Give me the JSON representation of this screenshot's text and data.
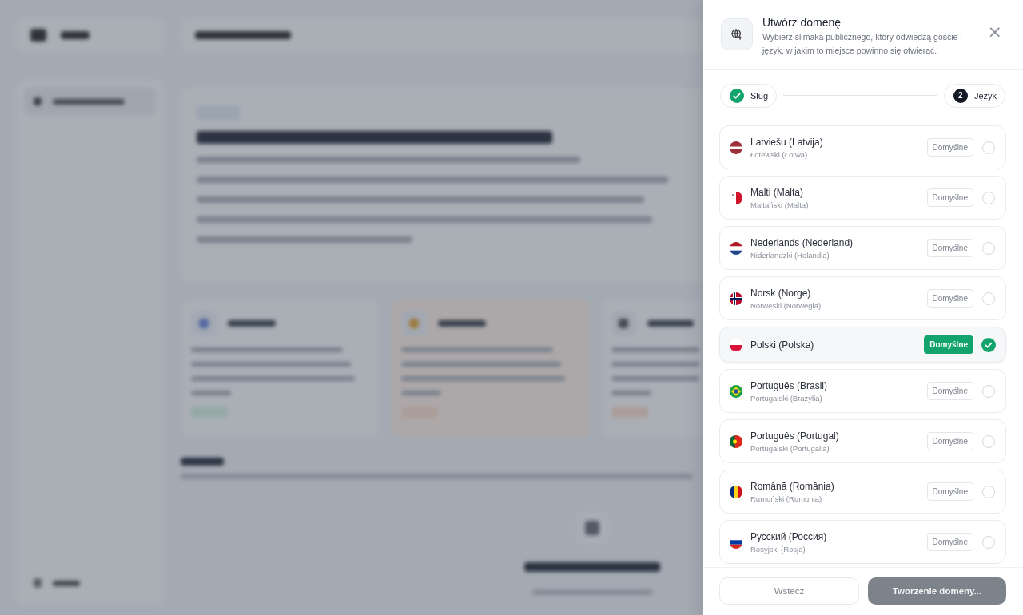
{
  "drawer": {
    "title": "Utwórz domenę",
    "description": "Wybierz ślimaka publicznego, który odwiedzą goście i język, w jakim to miejsce powinno się otwierać.",
    "close": "×",
    "steps": [
      {
        "label": "Slug",
        "done": true
      },
      {
        "label": "Język",
        "done": false,
        "number": "2"
      }
    ],
    "languages": [
      {
        "name": "Latviešu (Latvija)",
        "translation": "Łotewski (Łotwa)",
        "kind": "lv",
        "default_label": "Domyślne",
        "selected": false
      },
      {
        "name": "Malti (Malta)",
        "translation": "Maltański (Malta)",
        "kind": "mt",
        "default_label": "Domyślne",
        "selected": false
      },
      {
        "name": "Nederlands (Nederland)",
        "translation": "Niderlandzki (Holandia)",
        "kind": "nl",
        "default_label": "Domyślne",
        "selected": false
      },
      {
        "name": "Norsk (Norge)",
        "translation": "Norweski (Norwegia)",
        "kind": "no",
        "default_label": "Domyślne",
        "selected": false
      },
      {
        "name": "Polski (Polska)",
        "kind": "pl",
        "default_label": "Domyślne",
        "selected": true
      },
      {
        "name": "Português (Brasil)",
        "translation": "Portugalski (Brazylia)",
        "kind": "br",
        "default_label": "Domyślne",
        "selected": false
      },
      {
        "name": "Português (Portugal)",
        "translation": "Portugalski (Portugalia)",
        "kind": "pt",
        "default_label": "Domyślne",
        "selected": false
      },
      {
        "name": "Română (România)",
        "translation": "Rumuński (Rumunia)",
        "kind": "ro",
        "default_label": "Domyślne",
        "selected": false
      },
      {
        "name": "Русский (Россия)",
        "translation": "Rosyjski (Rosja)",
        "kind": "ru",
        "default_label": "Domyślne",
        "selected": false
      }
    ],
    "buttons": [
      {
        "label": "Wstecz",
        "kind": "secondary",
        "disabled": false
      },
      {
        "label": "Tworzenie domeny...",
        "kind": "primary",
        "disabled": true
      }
    ]
  }
}
